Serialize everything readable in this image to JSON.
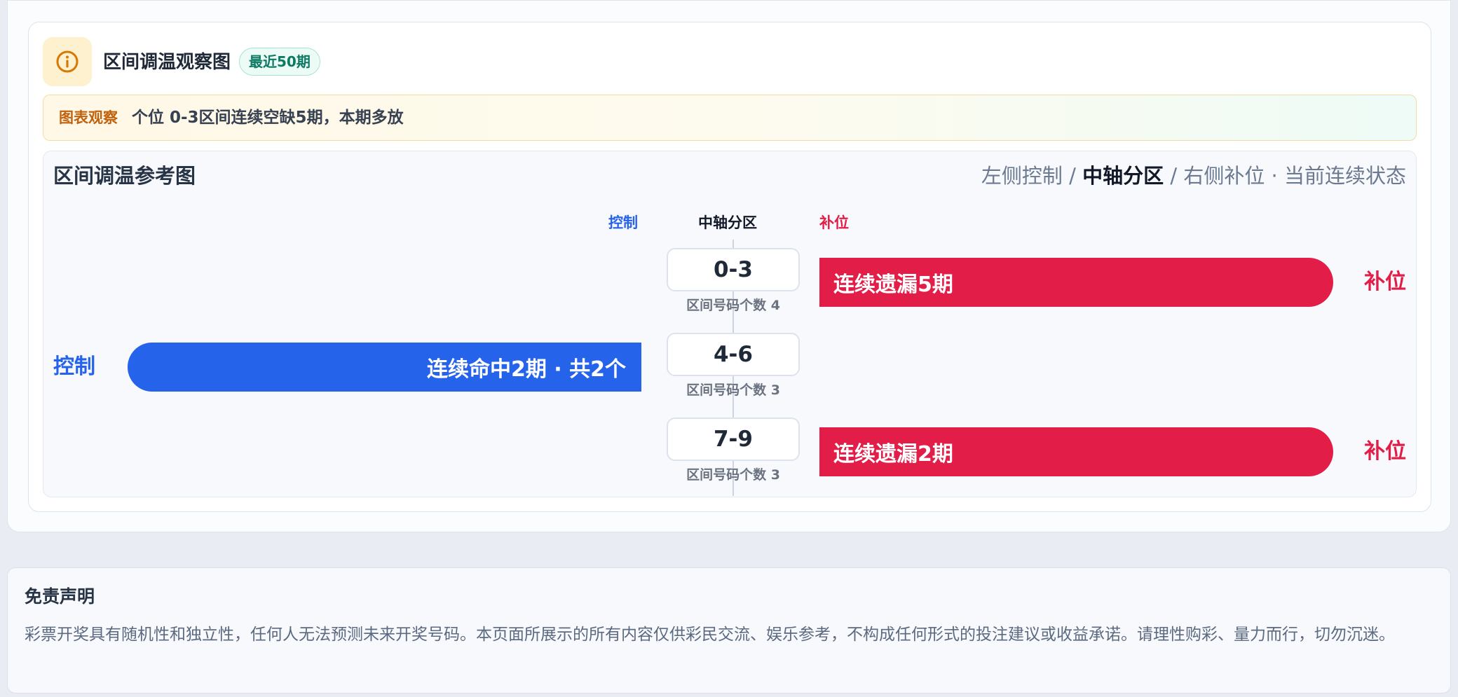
{
  "header": {
    "title": "区间调温观察图",
    "badge": "最近50期",
    "icon": "info-icon",
    "icon_color": "#d97706"
  },
  "observation": {
    "tag": "图表观察",
    "text": "个位 0-3区间连续空缺5期，本期多放"
  },
  "chart": {
    "title": "区间调温参考图",
    "legend_left": "左侧控制 / ",
    "legend_center": "中轴分区",
    "legend_right": " / 右侧补位 · 当前连续状态",
    "col_control": "控制",
    "col_axis": "中轴分区",
    "col_fill": "补位"
  },
  "colors": {
    "control": "#2563eb",
    "fill": "#e11d48"
  },
  "zones": [
    {
      "range": "0-3",
      "count_label": "区间号码个数 4",
      "side": "fill",
      "bar_label": "连续遗漏5期",
      "side_label": "补位"
    },
    {
      "range": "4-6",
      "count_label": "区间号码个数 3",
      "side": "control",
      "bar_label": "连续命中2期 · 共2个",
      "side_label": "控制"
    },
    {
      "range": "7-9",
      "count_label": "区间号码个数 3",
      "side": "fill",
      "bar_label": "连续遗漏2期",
      "side_label": "补位"
    }
  ],
  "disclaimer": {
    "title": "免责声明",
    "text": "彩票开奖具有随机性和独立性，任何人无法预测未来开奖号码。本页面所展示的所有内容仅供彩民交流、娱乐参考，不构成任何形式的投注建议或收益承诺。请理性购彩、量力而行，切勿沉迷。"
  }
}
